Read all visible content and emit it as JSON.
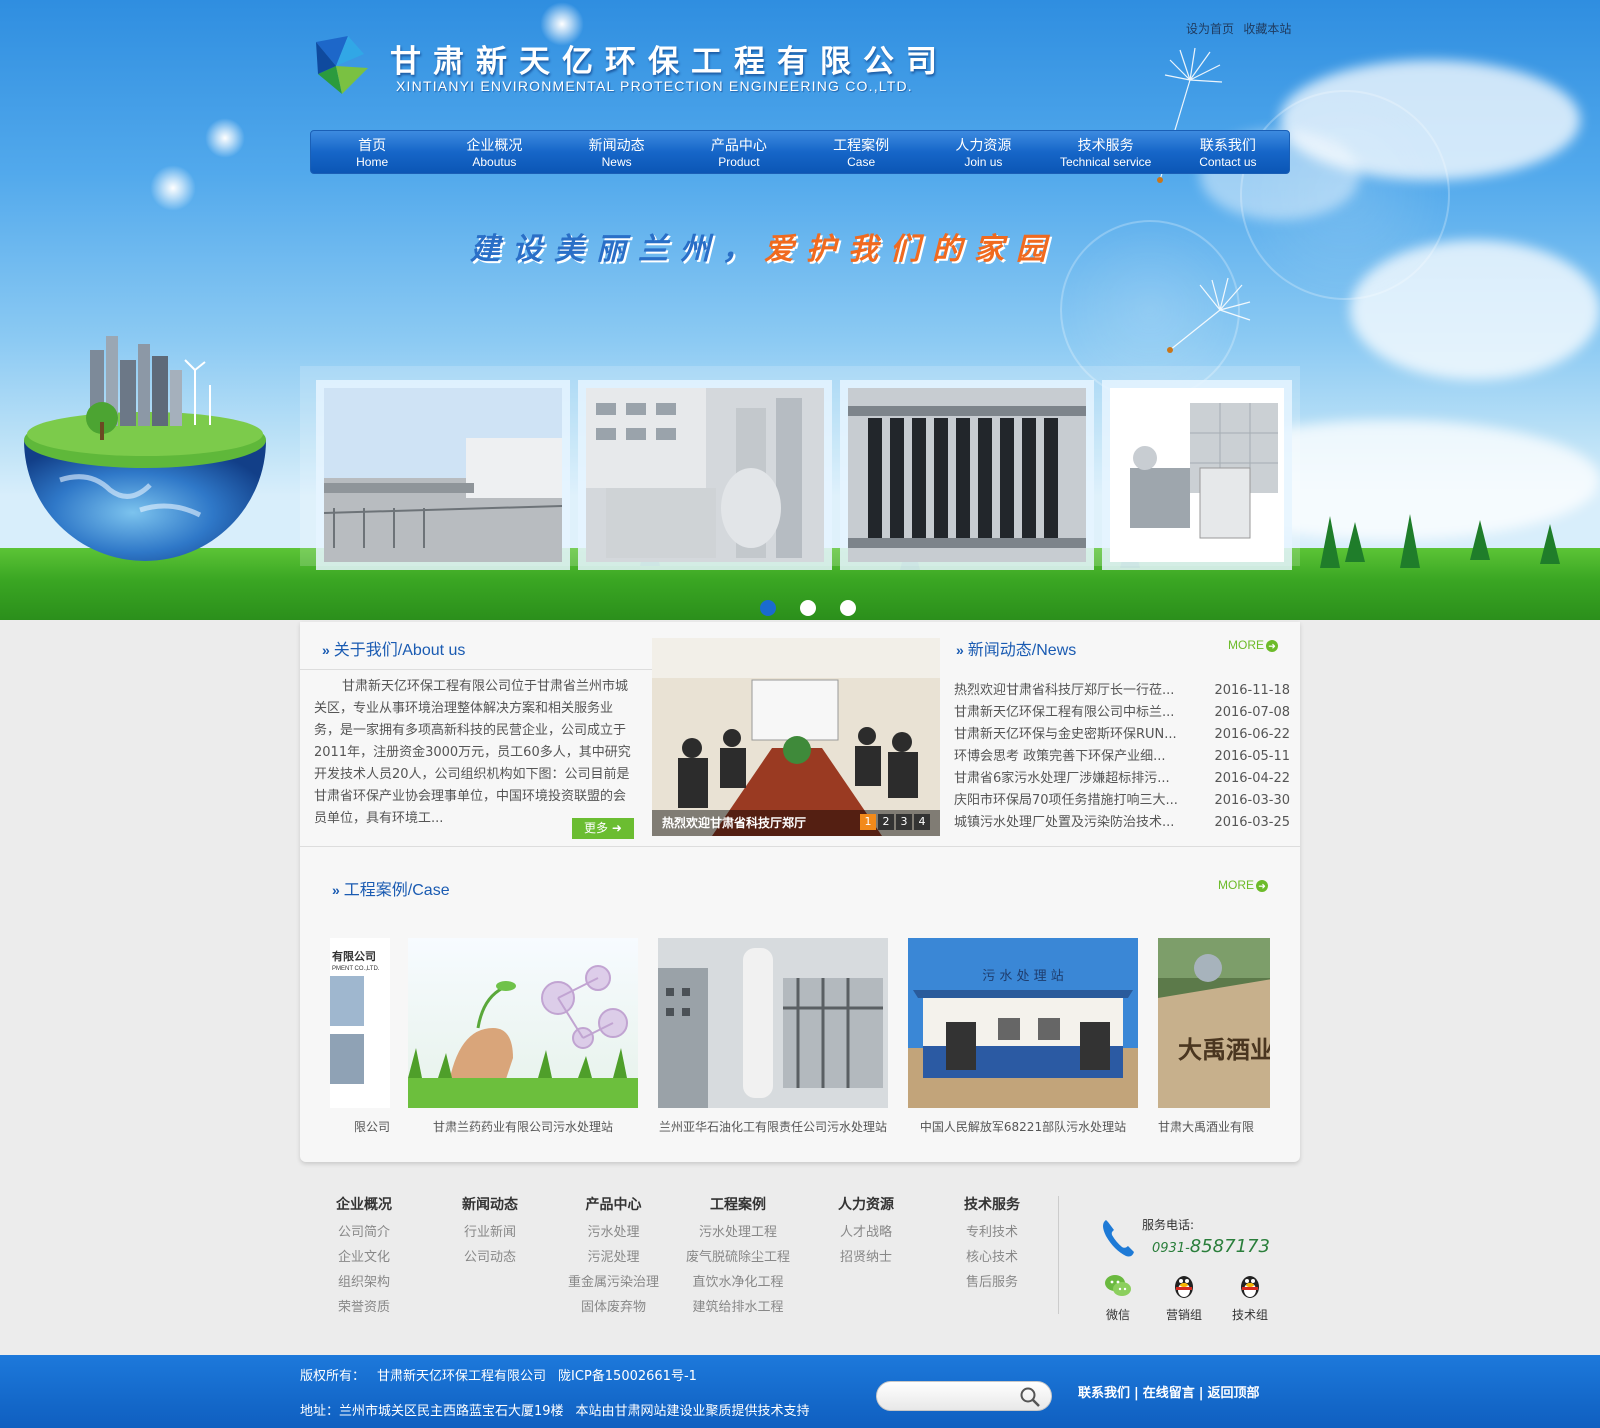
{
  "header": {
    "company_cn": "甘肃新天亿环保工程有限公司",
    "company_en": "XINTIANYI ENVIRONMENTAL PROTECTION ENGINEERING  CO.,LTD.",
    "top_links": [
      "设为首页",
      "收藏本站"
    ]
  },
  "nav": [
    {
      "cn": "首页",
      "en": "Home"
    },
    {
      "cn": "企业概况",
      "en": "Aboutus"
    },
    {
      "cn": "新闻动态",
      "en": "News"
    },
    {
      "cn": "产品中心",
      "en": "Product"
    },
    {
      "cn": "工程案例",
      "en": "Case"
    },
    {
      "cn": "人力资源",
      "en": "Join us"
    },
    {
      "cn": "技术服务",
      "en": "Technical service"
    },
    {
      "cn": "联系我们",
      "en": "Contact us"
    }
  ],
  "slogan": {
    "part1": "建设美丽兰州，",
    "part2": "爱护我们的家园"
  },
  "slider": {
    "active_dot": 1,
    "dot_count": 3
  },
  "about": {
    "title": "关于我们/About us",
    "text": "甘肃新天亿环保工程有限公司位于甘肃省兰州市城关区，专业从事环境治理整体解决方案和相关服务业务，是一家拥有多项高新科技的民营企业，公司成立于2011年，注册资金3000万元，员工60多人，其中研究开发技术人员20人，公司组织机构如下图：公司目前是甘肃省环保产业协会理事单位，中国环境投资联盟的会员单位，具有环境工...",
    "more_label": "更多"
  },
  "photo": {
    "caption": "热烈欢迎甘肃省科技厅郑厅",
    "pages": [
      "1",
      "2",
      "3",
      "4"
    ],
    "active_page": 1
  },
  "news": {
    "title": "新闻动态/News",
    "more_label": "MORE",
    "items": [
      {
        "title": "热烈欢迎甘肃省科技厅郑厅长一行莅...",
        "date": "2016-11-18"
      },
      {
        "title": "甘肃新天亿环保工程有限公司中标兰...",
        "date": "2016-07-08"
      },
      {
        "title": "甘肃新天亿环保与金史密斯环保RUN...",
        "date": "2016-06-22"
      },
      {
        "title": "环博会思考 政策完善下环保产业细...",
        "date": "2016-05-11"
      },
      {
        "title": "甘肃省6家污水处理厂涉嫌超标排污...",
        "date": "2016-04-22"
      },
      {
        "title": "庆阳市环保局70项任务措施打响三大...",
        "date": "2016-03-30"
      },
      {
        "title": "城镇污水处理厂处置及污染防治技术...",
        "date": "2016-03-25"
      }
    ]
  },
  "cases": {
    "title": "工程案例/Case",
    "more_label": "MORE",
    "items": [
      {
        "caption": "限公司",
        "partial_logo": "有限公司",
        "partial_logo_en": "PMENT CO.,LTD."
      },
      {
        "caption": "甘肃兰药药业有限公司污水处理站"
      },
      {
        "caption": "兰州亚华石油化工有限责任公司污水处理站"
      },
      {
        "caption": "中国人民解放军68221部队污水处理站",
        "sign": "污 水 处 理 站"
      },
      {
        "caption": "甘肃大禹酒业有限",
        "sign": "大禹酒业"
      }
    ]
  },
  "footer": {
    "columns": [
      {
        "heading": "企业概况",
        "links": [
          "公司简介",
          "企业文化",
          "组织架构",
          "荣誉资质"
        ]
      },
      {
        "heading": "新闻动态",
        "links": [
          "行业新闻",
          "公司动态"
        ]
      },
      {
        "heading": "产品中心",
        "links": [
          "污水处理",
          "污泥处理",
          "重金属污染治理",
          "固体废弃物"
        ]
      },
      {
        "heading": "工程案例",
        "links": [
          "污水处理工程",
          "废气脱硫除尘工程",
          "直饮水净化工程",
          "建筑给排水工程"
        ]
      },
      {
        "heading": "人力资源",
        "links": [
          "人才战略",
          "招贤纳士"
        ]
      },
      {
        "heading": "技术服务",
        "links": [
          "专利技术",
          "核心技术",
          "售后服务"
        ]
      }
    ],
    "service_label": "服务电话:",
    "phone_prefix": "0931-",
    "phone": "8587173",
    "social": [
      "微信",
      "营销组",
      "技术组"
    ]
  },
  "bottom": {
    "copyright_label": "版权所有：",
    "copyright_name": "甘肃新天亿环保工程有限公司",
    "icp": "陇ICP备15002661号-1",
    "address": "地址：兰州市城关区民主西路蓝宝石大厦19楼",
    "support": "本站由甘肃网站建设业聚质提供技术支持",
    "search_placeholder": "",
    "links": [
      "联系我们",
      "在线留言",
      "返回顶部"
    ]
  },
  "colors": {
    "nav_blue": "#1666c8",
    "title_blue": "#1a5bb2",
    "more_green": "#6dbb2a",
    "slogan_orange": "#f06a1f",
    "bottom_blue": "#0f5fc0"
  }
}
